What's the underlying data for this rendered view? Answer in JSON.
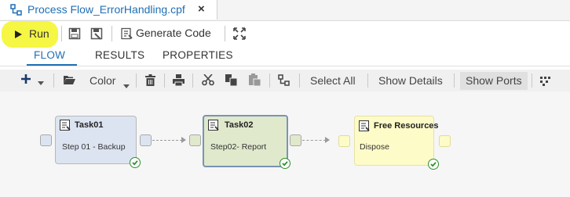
{
  "tab": {
    "title": "Process Flow_ErrorHandling.cpf",
    "close_glyph": "×"
  },
  "toolbar": {
    "run_label": "Run",
    "generate_code_label": "Generate Code"
  },
  "subtabs": [
    {
      "label": "FLOW",
      "active": true
    },
    {
      "label": "RESULTS",
      "active": false
    },
    {
      "label": "PROPERTIES",
      "active": false
    }
  ],
  "canvas_toolbar": {
    "color_label": "Color",
    "select_all_label": "Select All",
    "show_details_label": "Show Details",
    "show_ports_label": "Show Ports"
  },
  "nodes": [
    {
      "title": "Task01",
      "label": "Step 01 - Backup",
      "color": "#dde4f1",
      "status": "completed"
    },
    {
      "title": "Task02",
      "label": "Step02- Report",
      "color": "#e0e9cc",
      "status": "completed",
      "selected": true
    },
    {
      "title": "Free Resources",
      "label": "Dispose",
      "color": "#fdfbc8",
      "status": "completed"
    }
  ],
  "colors": {
    "accent": "#1f6fb5",
    "highlight": "#f5f53a",
    "status_ok": "#2f8f2f"
  }
}
